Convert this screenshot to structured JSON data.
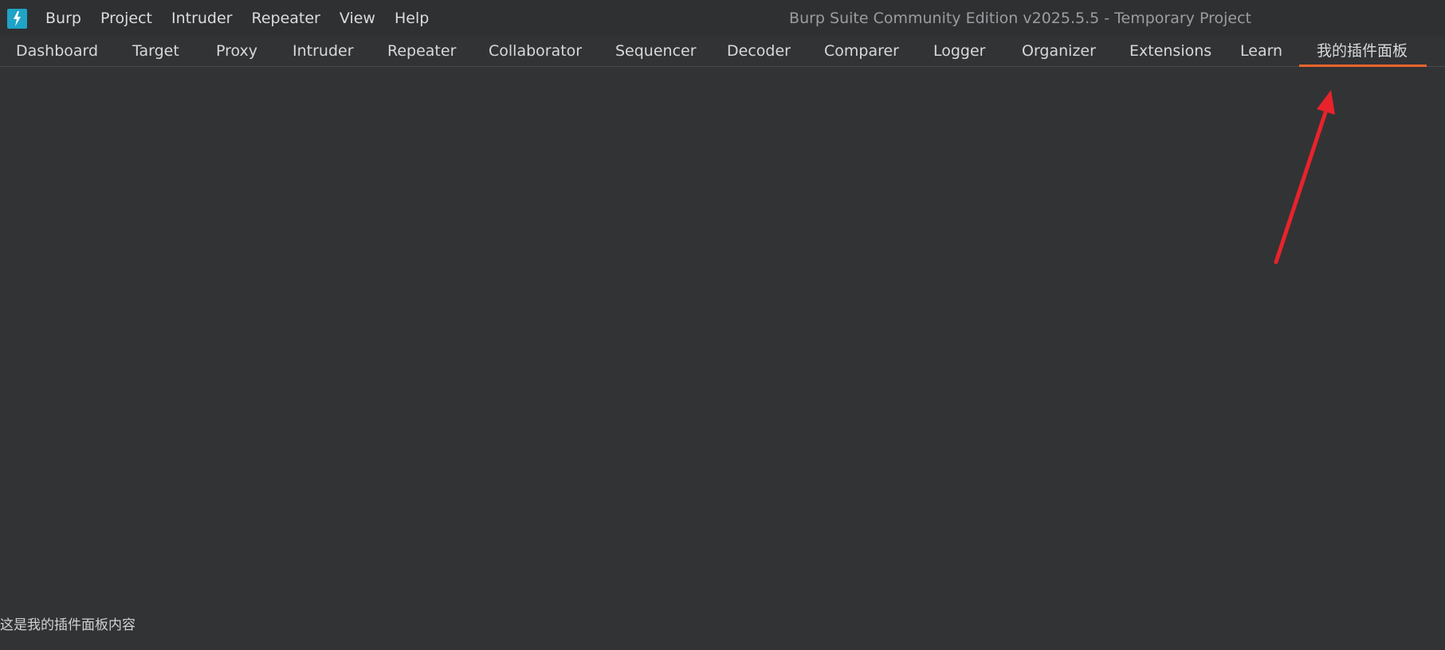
{
  "app": {
    "logo_icon": "burp-lightning-icon",
    "window_title": "Burp Suite Community Edition v2025.5.5 - Temporary Project"
  },
  "menu": {
    "items": [
      "Burp",
      "Project",
      "Intruder",
      "Repeater",
      "View",
      "Help"
    ]
  },
  "tabs": {
    "items": [
      {
        "label": "Dashboard"
      },
      {
        "label": "Target"
      },
      {
        "label": "Proxy"
      },
      {
        "label": "Intruder"
      },
      {
        "label": "Repeater"
      },
      {
        "label": "Collaborator"
      },
      {
        "label": "Sequencer"
      },
      {
        "label": "Decoder"
      },
      {
        "label": "Comparer"
      },
      {
        "label": "Logger"
      },
      {
        "label": "Organizer"
      },
      {
        "label": "Extensions"
      },
      {
        "label": "Learn"
      },
      {
        "label": "我的插件面板"
      }
    ],
    "active_index": 13,
    "accent_color": "#e8652e"
  },
  "panel": {
    "text": "这是我的插件面板内容"
  },
  "annotation": {
    "arrow_color": "#e8232b"
  }
}
